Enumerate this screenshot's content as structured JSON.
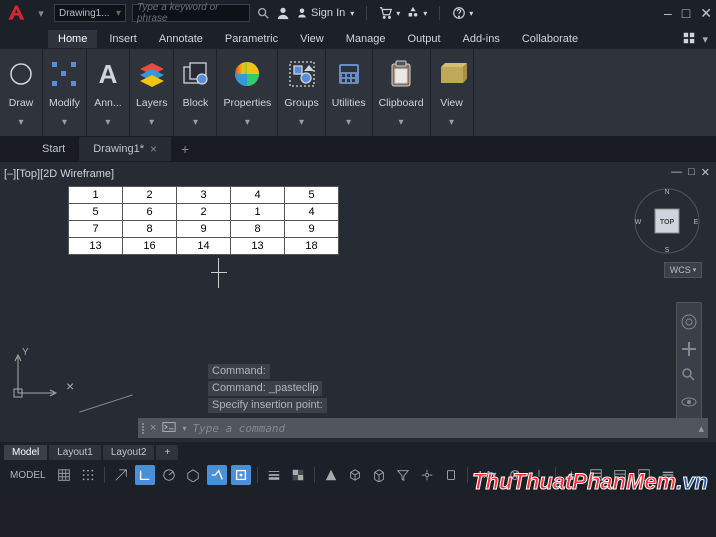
{
  "titlebar": {
    "dropdown": "Drawing1...",
    "search_placeholder": "Type a keyword or phrase",
    "signin": "Sign In"
  },
  "ribbon": {
    "tabs": [
      "Home",
      "Insert",
      "Annotate",
      "Parametric",
      "View",
      "Manage",
      "Output",
      "Add-ins",
      "Collaborate"
    ],
    "panels": [
      {
        "label": "Draw",
        "icon": "circle"
      },
      {
        "label": "Modify",
        "icon": "handles"
      },
      {
        "label": "Ann...",
        "icon": "letterA"
      },
      {
        "label": "Layers",
        "icon": "layers"
      },
      {
        "label": "Block",
        "icon": "block"
      },
      {
        "label": "Properties",
        "icon": "props"
      },
      {
        "label": "Groups",
        "icon": "groups"
      },
      {
        "label": "Utilities",
        "icon": "utils"
      },
      {
        "label": "Clipboard",
        "icon": "clip"
      },
      {
        "label": "View",
        "icon": "view"
      }
    ]
  },
  "doctabs": {
    "start": "Start",
    "active": "Drawing1*"
  },
  "viewport": {
    "label": "[–][Top][2D Wireframe]",
    "wcs": "WCS",
    "cube_face": "TOP",
    "compass": {
      "n": "N",
      "e": "E",
      "s": "S",
      "w": "W"
    }
  },
  "table_data": {
    "type": "table",
    "rows": [
      [
        1,
        2,
        3,
        4,
        5
      ],
      [
        5,
        6,
        2,
        1,
        4
      ],
      [
        7,
        8,
        9,
        8,
        9
      ],
      [
        13,
        16,
        14,
        13,
        18
      ]
    ]
  },
  "ucs": {
    "y": "Y"
  },
  "cmd": {
    "line1": "Command:",
    "line2": "Command: _pasteclip",
    "line3": "Specify insertion point:",
    "placeholder": "Type a command"
  },
  "layouts": [
    "Model",
    "Layout1",
    "Layout2"
  ],
  "status": {
    "scale": "1:1"
  },
  "watermark": {
    "a": "ThuThuatPhanMem",
    "b": ".vn"
  }
}
